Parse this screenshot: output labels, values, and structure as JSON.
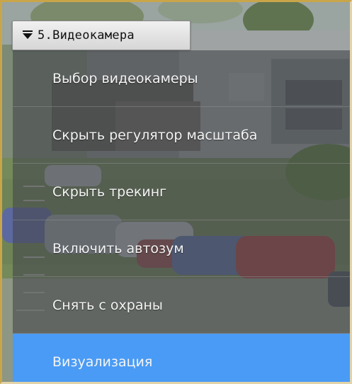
{
  "camera": {
    "title": "5.Видеокамера",
    "dropdown_icon": "dropdown-arrow-icon"
  },
  "menu": {
    "items": [
      {
        "label": "Выбор видеокамеры",
        "active": false
      },
      {
        "label": "Скрыть регулятор масштаба",
        "active": false
      },
      {
        "label": "Скрыть трекинг",
        "active": false
      },
      {
        "label": "Включить автозум",
        "active": false
      },
      {
        "label": "Снять с охраны",
        "active": false
      },
      {
        "label": "Визуализация",
        "active": true
      }
    ]
  },
  "colors": {
    "active_item": "#4a9bf5",
    "frame_border": "#c9a54a"
  }
}
